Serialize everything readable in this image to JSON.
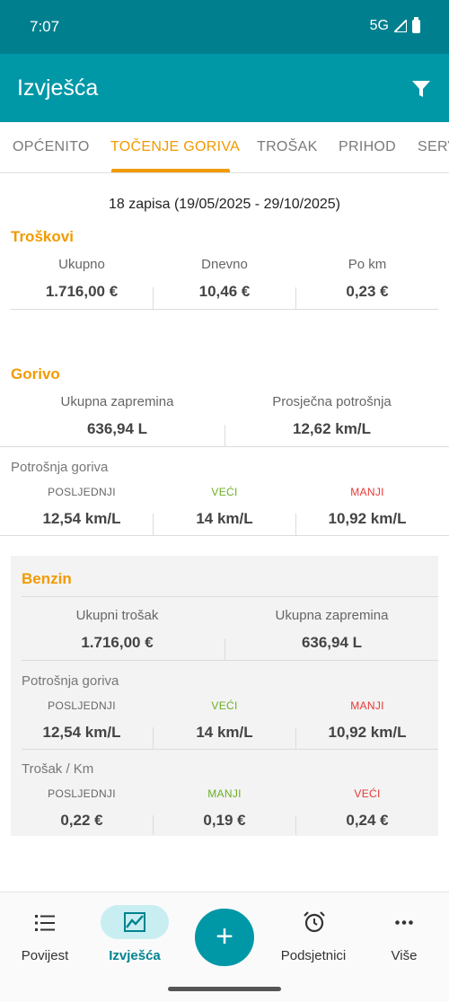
{
  "status": {
    "time": "7:07",
    "network": "5G"
  },
  "app_bar": {
    "title": "Izvješća"
  },
  "tabs": [
    "OPĆENITO",
    "TOČENJE GORIVA",
    "TROŠAK",
    "PRIHOD",
    "SERV"
  ],
  "active_tab": "TOČENJE GORIVA",
  "summary": "18 zapisa (19/05/2025 - 29/10/2025)",
  "costs": {
    "title": "Troškovi",
    "items": [
      {
        "label": "Ukupno",
        "value": "1.716,00 €"
      },
      {
        "label": "Dnevno",
        "value": "10,46 €"
      },
      {
        "label": "Po km",
        "value": "0,23 €"
      }
    ]
  },
  "fuel": {
    "title": "Gorivo",
    "total_volume": {
      "label": "Ukupna zapremina",
      "value": "636,94 L"
    },
    "avg_consumption": {
      "label": "Prosječna potrošnja",
      "value": "12,62 km/L"
    },
    "consumption_title": "Potrošnja goriva",
    "consumption": [
      {
        "label": "POSLJEDNJI",
        "value": "12,54 km/L"
      },
      {
        "label": "VEĆI",
        "value": "14 km/L"
      },
      {
        "label": "MANJI",
        "value": "10,92 km/L"
      }
    ]
  },
  "benzin": {
    "title": "Benzin",
    "total_cost": {
      "label": "Ukupni trošak",
      "value": "1.716,00 €"
    },
    "total_volume": {
      "label": "Ukupna zapremina",
      "value": "636,94 L"
    },
    "consumption_title": "Potrošnja goriva",
    "consumption": [
      {
        "label": "POSLJEDNJI",
        "value": "12,54 km/L"
      },
      {
        "label": "VEĆI",
        "value": "14 km/L"
      },
      {
        "label": "MANJI",
        "value": "10,92 km/L"
      }
    ],
    "cost_km_title": "Trošak / Km",
    "cost_km": [
      {
        "label": "POSLJEDNJI",
        "value": "0,22 €"
      },
      {
        "label": "MANJI",
        "value": "0,19 €"
      },
      {
        "label": "VEĆI",
        "value": "0,24 €"
      }
    ]
  },
  "bottom_nav": {
    "items": [
      {
        "label": "Povijest",
        "icon": "list-icon"
      },
      {
        "label": "Izvješća",
        "icon": "chart-icon"
      },
      {
        "label": "Podsjetnici",
        "icon": "alarm-clock-icon"
      },
      {
        "label": "Više",
        "icon": "more-icon"
      }
    ],
    "fab": "+"
  },
  "colors": {
    "primary": "#0097a7",
    "status_bar": "#00808f",
    "accent": "#f29a00",
    "green": "#6ab023",
    "red": "#e53935"
  }
}
